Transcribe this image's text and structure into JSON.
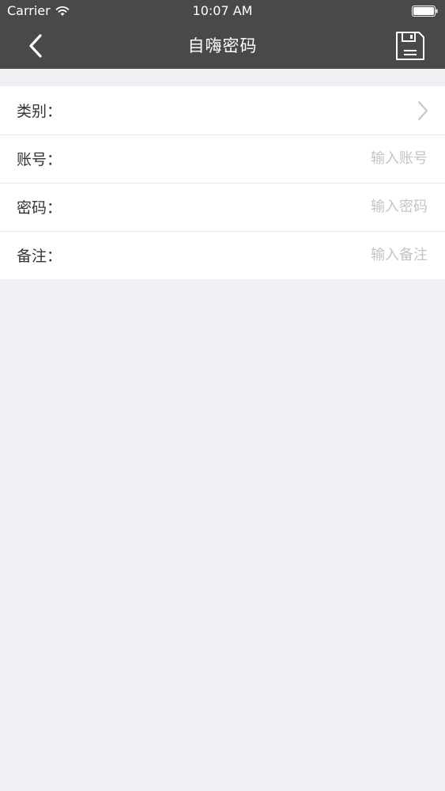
{
  "status_bar": {
    "carrier": "Carrier",
    "time": "10:07 AM"
  },
  "nav": {
    "title": "自嗨密码",
    "back_icon": "chevron-left-icon",
    "save_icon": "floppy-disk-icon"
  },
  "form": {
    "rows": [
      {
        "label": "类别：",
        "placeholder": "",
        "value": ""
      },
      {
        "label": "账号：",
        "placeholder": "输入账号",
        "value": ""
      },
      {
        "label": "密码：",
        "placeholder": "输入密码",
        "value": ""
      },
      {
        "label": "备注：",
        "placeholder": "输入备注",
        "value": ""
      }
    ]
  },
  "colors": {
    "nav_background": "#4a4848",
    "page_background": "#f0eff4",
    "placeholder": "#c4c4c9"
  }
}
